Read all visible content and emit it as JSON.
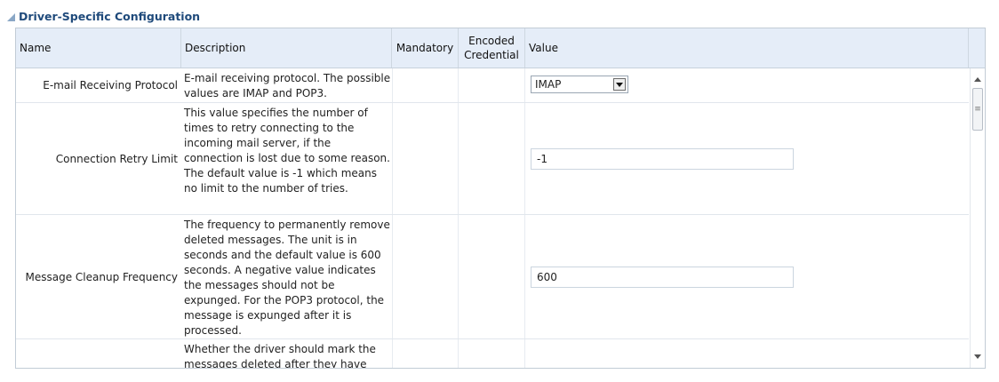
{
  "section": {
    "title": "Driver-Specific Configuration"
  },
  "table": {
    "headers": {
      "name": "Name",
      "description": "Description",
      "mandatory": "Mandatory",
      "encoded_line1": "Encoded",
      "encoded_line2": "Credential",
      "value": "Value"
    },
    "rows": [
      {
        "name": "E-mail Receiving Protocol",
        "description": "E-mail receiving protocol. The possible values are IMAP and POP3.",
        "value": "IMAP",
        "control": "select"
      },
      {
        "name": "Connection Retry Limit",
        "description": "This value specifies the number of times to retry connecting to the incoming mail server, if the connection is lost due to some reason. The default value is -1 which means no limit to the number of tries.",
        "value": "-1",
        "control": "text"
      },
      {
        "name": "Message Cleanup Frequency",
        "description": "The frequency to permanently remove deleted messages. The unit is in seconds and the default value is 600 seconds. A negative value indicates the messages should not be expunged. For the POP3 protocol, the message is expunged after it is processed.",
        "value": "600",
        "control": "text"
      },
      {
        "name": "",
        "description": "Whether the driver should mark the messages deleted after they have been",
        "value": "",
        "control": "none"
      }
    ]
  },
  "scrollbar": {
    "thumb_glyph": "≡"
  }
}
